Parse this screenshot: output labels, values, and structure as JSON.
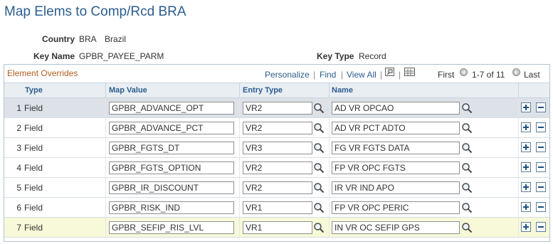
{
  "page": {
    "title": "Map Elems to Comp/Rcd BRA"
  },
  "info": {
    "country_label": "Country",
    "country_code": "BRA",
    "country_name": "Brazil",
    "key_name_label": "Key Name",
    "key_name_value": "GPBR_PAYEE_PARM",
    "key_type_label": "Key Type",
    "key_type_value": "Record"
  },
  "grid": {
    "title": "Element Overrides",
    "personalize": "Personalize",
    "find": "Find",
    "view_all": "View All",
    "sep": "|",
    "first": "First",
    "range": "1-7 of 11",
    "last": "Last",
    "columns": {
      "type": "Type",
      "map_value": "Map Value",
      "entry_type": "Entry Type",
      "name": "Name"
    },
    "rows": [
      {
        "num": "1",
        "type": "Field",
        "map_value": "GPBR_ADVANCE_OPT",
        "entry_type": "VR2",
        "name": "AD VR OPCAO"
      },
      {
        "num": "2",
        "type": "Field",
        "map_value": "GPBR_ADVANCE_PCT",
        "entry_type": "VR2",
        "name": "AD VR PCT ADTO"
      },
      {
        "num": "3",
        "type": "Field",
        "map_value": "GPBR_FGTS_DT",
        "entry_type": "VR3",
        "name": "FG VR FGTS DATA"
      },
      {
        "num": "4",
        "type": "Field",
        "map_value": "GPBR_FGTS_OPTION",
        "entry_type": "VR2",
        "name": "FP VR OPC FGTS"
      },
      {
        "num": "5",
        "type": "Field",
        "map_value": "GPBR_IR_DISCOUNT",
        "entry_type": "VR2",
        "name": "IR VR IND APO"
      },
      {
        "num": "6",
        "type": "Field",
        "map_value": "GPBR_RISK_IND",
        "entry_type": "VR1",
        "name": "FP VR OPC PERIC"
      },
      {
        "num": "7",
        "type": "Field",
        "map_value": "GPBR_SEFIP_RIS_LVL",
        "entry_type": "VR1",
        "name": "IN VR OC SEFIP GPS"
      }
    ]
  },
  "icons": {
    "lookup": "magnifier-icon",
    "add": "plus-icon",
    "delete": "minus-icon",
    "zoom": "zoom-icon",
    "download": "spreadsheet-icon",
    "prev": "previous-icon",
    "next": "next-icon"
  },
  "colors": {
    "title": "#2b5d8e",
    "grid_title": "#b45d1e",
    "header_bg": "#e9eef3",
    "row_selected": "#dde2e8",
    "row_highlight": "#f8f9d8"
  }
}
